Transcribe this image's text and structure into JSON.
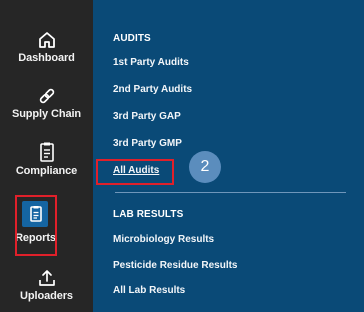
{
  "sidebar": {
    "items": [
      {
        "label": "Dashboard",
        "icon": "home-icon"
      },
      {
        "label": "Supply Chain",
        "icon": "chain-link-icon"
      },
      {
        "label": "Compliance",
        "icon": "clipboard-icon"
      },
      {
        "label": "Reports",
        "icon": "report-icon",
        "selected": true
      },
      {
        "label": "Uploaders",
        "icon": "upload-icon"
      }
    ]
  },
  "menu": {
    "audits_heading": "AUDITS",
    "audits": [
      "1st Party Audits",
      "2nd Party Audits",
      "3rd Party GAP",
      "3rd Party GMP",
      "All Audits"
    ],
    "lab_heading": "LAB RESULTS",
    "lab": [
      "Microbiology Results",
      "Pesticide Residue Results",
      "All Lab Results"
    ]
  },
  "annotation": {
    "step": "2"
  },
  "colors": {
    "rail_bg": "#262626",
    "panel_bg": "#0a4a77",
    "selected_tile": "#1565a2",
    "highlight": "#e0202a",
    "badge": "#5b8dbd"
  }
}
